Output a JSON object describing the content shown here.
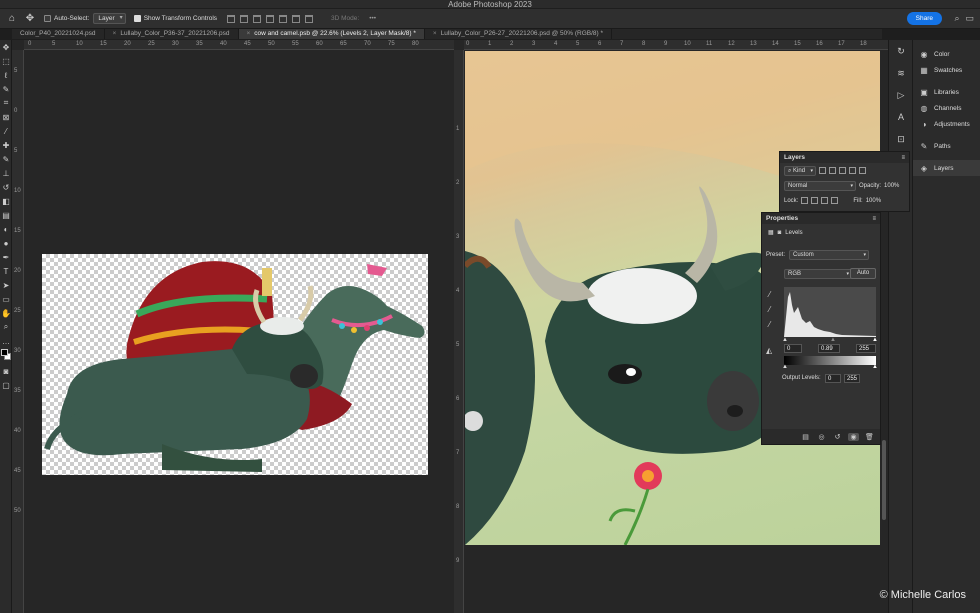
{
  "app": {
    "title": "Adobe Photoshop 2023"
  },
  "options_bar": {
    "auto_select_label": "Auto-Select:",
    "auto_select_value": "Layer",
    "show_transform_controls_label": "Show Transform Controls",
    "mode_3d_label": "3D Mode:",
    "more": "•••",
    "share_label": "Share"
  },
  "tabs": [
    {
      "label": "Color_P40_20221024.psd"
    },
    {
      "label": "Lullaby_Color_P36-37_20221206.psd"
    },
    {
      "label": "cow and camel.psb @ 22.6% (Levels 2, Layer Mask/8) *"
    },
    {
      "label": "Lullaby_Color_P26-27_20221206.psd @ 50% (RGB/8) *"
    }
  ],
  "left_doc": {
    "ruler_top": [
      "0",
      "5",
      "10",
      "15",
      "20",
      "25",
      "30",
      "35",
      "40",
      "45",
      "50",
      "55",
      "60",
      "65",
      "70",
      "75",
      "80"
    ],
    "ruler_left": [
      "5",
      "0",
      "5",
      "10",
      "15",
      "20",
      "25",
      "30",
      "35",
      "40",
      "45",
      "50"
    ]
  },
  "right_doc": {
    "ruler_top": [
      "0",
      "1",
      "2",
      "3",
      "4",
      "5",
      "6",
      "7",
      "8",
      "9",
      "10",
      "11",
      "12",
      "13",
      "14",
      "15",
      "16",
      "17",
      "18"
    ],
    "ruler_left": [
      "1",
      "2",
      "3",
      "4",
      "5",
      "6",
      "7",
      "8",
      "9"
    ]
  },
  "panel_strip": [
    {
      "label": "Color",
      "icon": "color-icon"
    },
    {
      "label": "Swatches",
      "icon": "swatches-icon"
    },
    {
      "label": "Libraries",
      "icon": "libraries-icon"
    },
    {
      "label": "Channels",
      "icon": "channels-icon"
    },
    {
      "label": "Adjustments",
      "icon": "adjustments-icon"
    },
    {
      "label": "Paths",
      "icon": "paths-icon"
    },
    {
      "label": "Layers",
      "icon": "layers-icon"
    }
  ],
  "layers_panel": {
    "title": "Layers",
    "filter_label": "Kind",
    "blend_mode": "Normal",
    "opacity_label": "Opacity:",
    "opacity_value": "100%",
    "lock_label": "Lock:",
    "fill_label": "Fill:",
    "fill_value": "100%"
  },
  "properties_panel": {
    "title": "Properties",
    "adjustment_name": "Levels",
    "preset_label": "Preset:",
    "preset_value": "Custom",
    "channel_value": "RGB",
    "auto_label": "Auto",
    "input_black": "0",
    "input_gamma": "0.89",
    "input_white": "255",
    "output_label": "Output Levels:",
    "output_black": "0",
    "output_white": "255"
  },
  "copyright": "© Michelle Carlos"
}
